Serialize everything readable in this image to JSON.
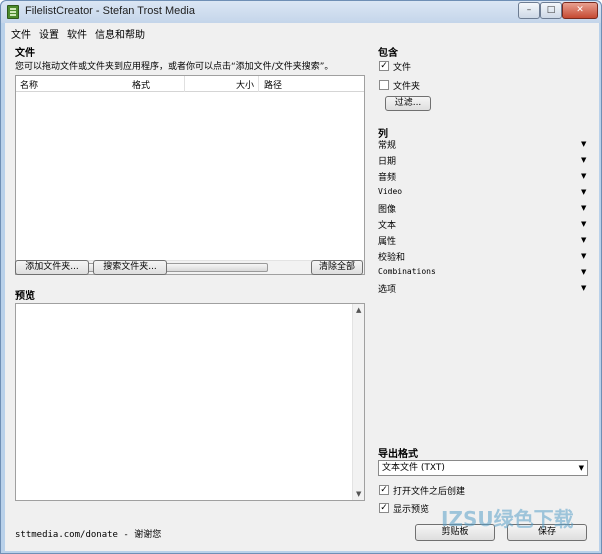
{
  "window": {
    "title": "FilelistCreator - Stefan Trost Media",
    "controls": {
      "minimize": "–",
      "maximize": "□",
      "close": "✕"
    }
  },
  "menu": [
    "文件",
    "设置",
    "软件",
    "信息和帮助"
  ],
  "files_section": {
    "title": "文件",
    "hint": "您可以拖动文件或文件夹到应用程序，或者你可以点击“添加文件/文件夹搜索”。",
    "columns": [
      "名称",
      "格式",
      "大小",
      "路径"
    ],
    "scroll_grip": "|||",
    "scroll_left": "◀",
    "scroll_right": "▶",
    "buttons": {
      "add_folder": "添加文件夹...",
      "search_folder": "搜索文件夹...",
      "clear_all": "清除全部"
    }
  },
  "preview_section": {
    "title": "预览"
  },
  "footer": {
    "text": "sttmedia.com/donate - 谢谢您"
  },
  "include": {
    "title": "包含",
    "files_label": "文件",
    "files_checked": true,
    "folders_label": "文件夹",
    "folders_checked": false,
    "filter_button": "过滤..."
  },
  "columns_section": {
    "title": "列",
    "items": [
      "常规",
      "日期",
      "音频",
      "Video",
      "图像",
      "文本",
      "属性",
      "校验和",
      "Combinations",
      "选项"
    ],
    "arrow": "▼"
  },
  "export": {
    "title": "导出格式",
    "format_value": "文本文件 (TXT)",
    "open_after_create_label": "打开文件之后创建",
    "open_after_create_checked": true,
    "show_preview_label": "显示预览",
    "show_preview_checked": true,
    "clipboard_button": "剪贴板",
    "save_button": "保存"
  },
  "watermark": {
    "text": "IZSU绿色下载"
  },
  "checkmark": "✓"
}
